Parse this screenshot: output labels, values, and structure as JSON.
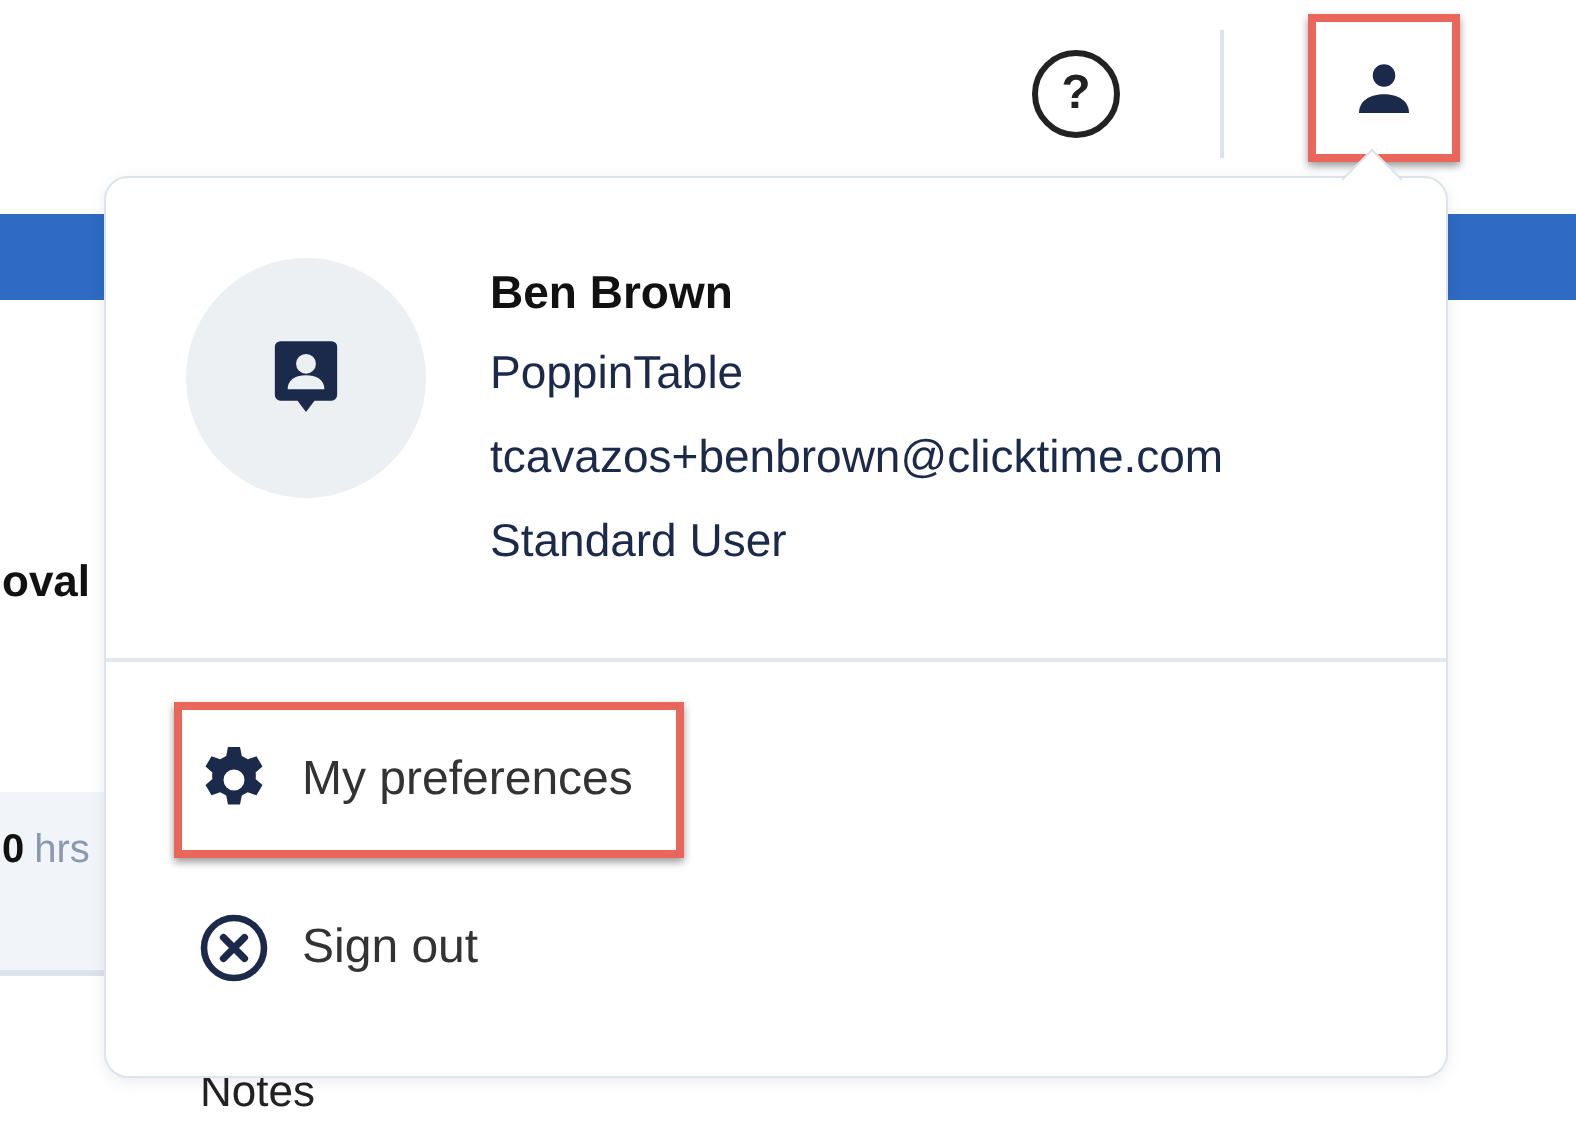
{
  "header": {
    "help_label": "?",
    "user_button": {
      "highlighted": true
    }
  },
  "background": {
    "heading": "oval",
    "card_value": "0",
    "card_unit": "hrs",
    "notes_label": "Notes"
  },
  "user_menu": {
    "name": "Ben Brown",
    "company": "PoppinTable",
    "email": "tcavazos+benbrown@clicktime.com",
    "role": "Standard User",
    "items": [
      {
        "kind": "preferences",
        "label": "My preferences",
        "highlighted": true
      },
      {
        "kind": "sign_out",
        "label": "Sign out",
        "highlighted": false
      }
    ]
  }
}
